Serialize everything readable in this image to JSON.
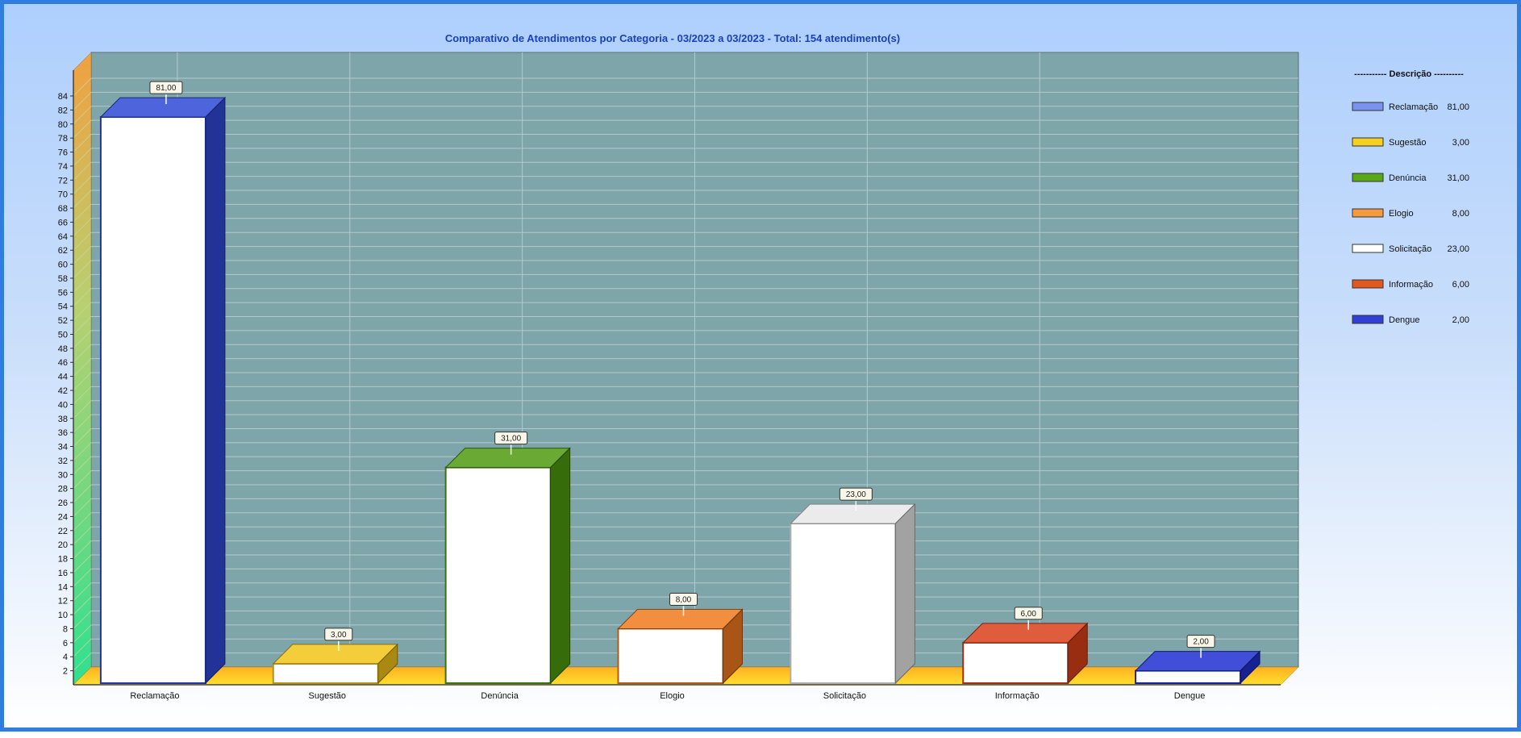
{
  "chart_data": {
    "type": "bar",
    "title": "Comparativo de Atendimentos por Categoria - 03/2023 a 03/2023 - Total: 154 atendimento(s)",
    "categories": [
      "Reclamação",
      "Sugestão",
      "Denúncia",
      "Elogio",
      "Solicitação",
      "Informação",
      "Dengue"
    ],
    "values": [
      81,
      3,
      31,
      8,
      23,
      6,
      2
    ],
    "value_labels": [
      "81,00",
      "3,00",
      "31,00",
      "8,00",
      "23,00",
      "6,00",
      "2,00"
    ],
    "colors": [
      "#2f49d6",
      "#f2c418",
      "#4f9a10",
      "#f07a1e",
      "#e8e8e8",
      "#d9401a",
      "#1f2fd0"
    ],
    "ylim": [
      0,
      84
    ],
    "yticks": [
      2,
      4,
      6,
      8,
      10,
      12,
      14,
      16,
      18,
      20,
      22,
      24,
      26,
      28,
      30,
      32,
      34,
      36,
      38,
      40,
      42,
      44,
      46,
      48,
      50,
      52,
      54,
      56,
      58,
      60,
      62,
      64,
      66,
      68,
      70,
      72,
      74,
      76,
      78,
      80,
      82,
      84
    ],
    "grid": true,
    "legend_position": "right",
    "legend": {
      "title": "----------- Descrição ----------",
      "entries": [
        {
          "label": "Reclamação",
          "value": "81,00",
          "color": "#7a93f0"
        },
        {
          "label": "Sugestão",
          "value": "3,00",
          "color": "#f5d020"
        },
        {
          "label": "Denúncia",
          "value": "31,00",
          "color": "#5aa818"
        },
        {
          "label": "Elogio",
          "value": "8,00",
          "color": "#f59a40"
        },
        {
          "label": "Solicitação",
          "value": "23,00",
          "color": "#ffffff"
        },
        {
          "label": "Informação",
          "value": "6,00",
          "color": "#e05a20"
        },
        {
          "label": "Dengue",
          "value": "2,00",
          "color": "#2f3fd8"
        }
      ]
    }
  }
}
